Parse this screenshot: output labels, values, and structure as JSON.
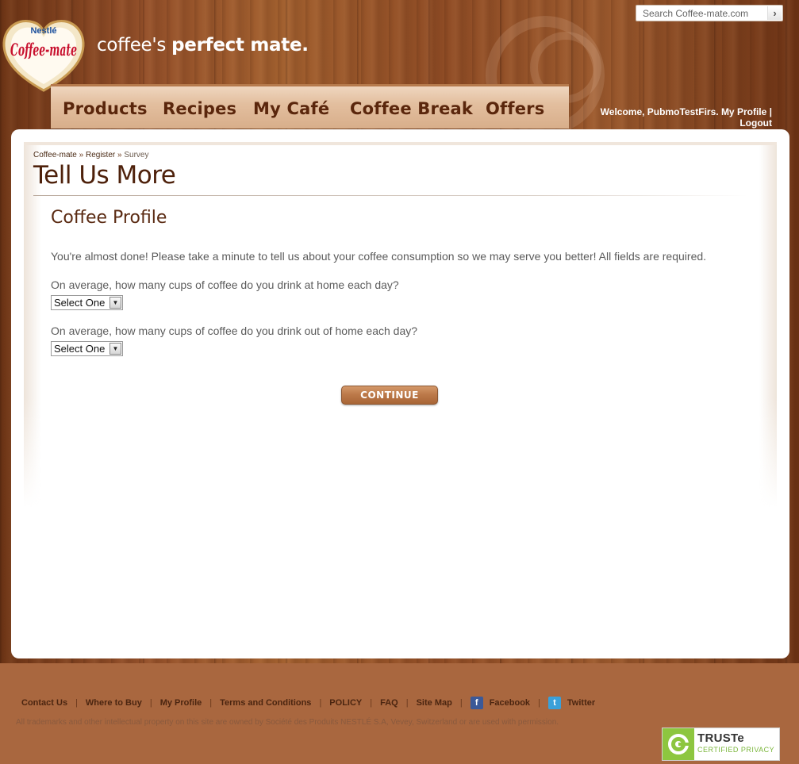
{
  "brand": {
    "logo_top": "Nestlé",
    "logo_main": "Coffee-mate",
    "tagline_light": "coffee's",
    "tagline_bold": "perfect mate."
  },
  "search": {
    "placeholder": "Search Coffee-mate.com"
  },
  "nav": {
    "items": [
      {
        "label": "Products"
      },
      {
        "label": "Recipes"
      },
      {
        "label": "My Café"
      },
      {
        "label": "Coffee Break"
      },
      {
        "label": "Offers"
      }
    ]
  },
  "user": {
    "welcome": "Welcome, PubmoTestFirs.",
    "my_profile": "My Profile",
    "divider": "|",
    "logout": "Logout"
  },
  "breadcrumb": {
    "items": [
      "Coffee-mate",
      "Register",
      "Survey"
    ],
    "separator": "»"
  },
  "page": {
    "title": "Tell Us More",
    "section_title": "Coffee Profile",
    "intro": "You're almost done! Please take a minute to tell us about your coffee consumption so we may serve you better! All fields are required.",
    "questions": [
      {
        "label": "On average, how many cups of coffee do you drink at home each day?",
        "selected": "Select One"
      },
      {
        "label": "On average, how many cups of coffee do you drink out of home each day?",
        "selected": "Select One"
      }
    ],
    "continue_label": "CONTINUE"
  },
  "footer": {
    "links": [
      "Contact Us",
      "Where to Buy",
      "My Profile",
      "Terms and Conditions",
      "POLICY",
      "FAQ",
      "Site Map",
      "Facebook",
      "Twitter"
    ],
    "separator": "|",
    "legal": "All trademarks and other intellectual property on this site are owned by Société des Produits NESTLÉ S.A, Vevey, Switzerland or are used with permission.",
    "truste_name": "TRUSTe",
    "truste_sub": "CERTIFIED PRIVACY"
  },
  "colors": {
    "wood": "#94502a",
    "nav_text": "#5a260c",
    "heading": "#4e210b",
    "button": "#bd7a4a",
    "footer_bg": "#a9673f"
  }
}
